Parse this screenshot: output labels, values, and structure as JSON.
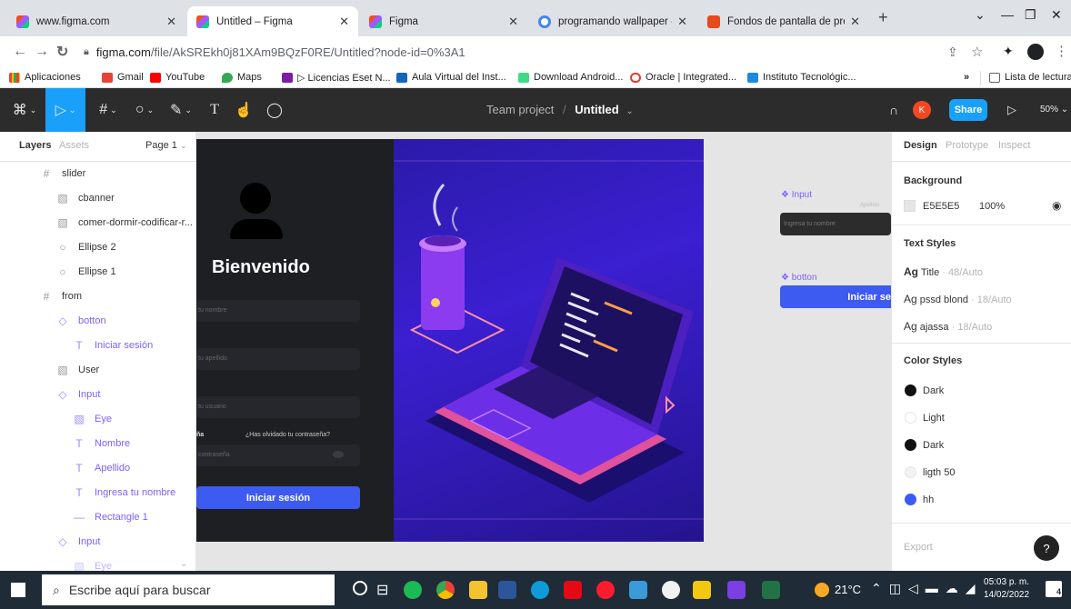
{
  "browser": {
    "tabs": [
      {
        "label": "www.figma.com"
      },
      {
        "label": "Untitled – Figma"
      },
      {
        "label": "Figma"
      },
      {
        "label": "programando wallpaper - Bú"
      },
      {
        "label": "Fondos de pantalla de progr"
      }
    ],
    "url_host": "figma.com",
    "url_path": "/file/AkSREkh0j81XAm9BQzF0RE/Untitled?node-id=0%3A1",
    "bookmarks": [
      "Aplicaciones",
      "Gmail",
      "YouTube",
      "Maps",
      "▷ Licencias Eset N...",
      "Aula Virtual del Inst...",
      "Download Android...",
      "Oracle | Integrated...",
      "Instituto Tecnológic..."
    ],
    "reading_list": "Lista de lectura"
  },
  "figma": {
    "project": "Team project",
    "file": "Untitled",
    "share": "Share",
    "zoom": "50%",
    "avatar": "K",
    "left_tabs": {
      "layers": "Layers",
      "assets": "Assets",
      "page": "Page 1"
    },
    "layers": [
      {
        "label": "slider"
      },
      {
        "label": "cbanner"
      },
      {
        "label": "comer-dormir-codificar-r..."
      },
      {
        "label": "Ellipse 2"
      },
      {
        "label": "Ellipse 1"
      },
      {
        "label": "from"
      },
      {
        "label": "botton"
      },
      {
        "label": "Iniciar sesión"
      },
      {
        "label": "User"
      },
      {
        "label": "Input"
      },
      {
        "label": "Eye"
      },
      {
        "label": "Nombre"
      },
      {
        "label": "Apellido"
      },
      {
        "label": "Ingresa tu nombre"
      },
      {
        "label": "Rectangle 1"
      },
      {
        "label": "Input"
      },
      {
        "label": "Eye"
      }
    ],
    "right_tabs": {
      "design": "Design",
      "prototype": "Prototype",
      "inspect": "Inspect"
    },
    "background": {
      "title": "Background",
      "hex": "E5E5E5",
      "opacity": "100%"
    },
    "text_styles": {
      "title": "Text Styles",
      "items": [
        {
          "name": "Title",
          "spec": "· 48/Auto"
        },
        {
          "name": "pssd blond",
          "spec": "· 18/Auto"
        },
        {
          "name": "ajassa",
          "spec": "· 18/Auto"
        }
      ]
    },
    "color_styles": {
      "title": "Color Styles",
      "items": [
        {
          "name": "Dark",
          "color": "#111111"
        },
        {
          "name": "Light",
          "color": "#ffffff"
        },
        {
          "name": "Dark",
          "color": "#111111"
        },
        {
          "name": "ligth 50",
          "color": "#f2f2f2"
        },
        {
          "name": "hh",
          "color": "#3b5bf5"
        }
      ]
    },
    "export": "Export",
    "help": "?",
    "canvas": {
      "welcome": "Bienvenido",
      "forgot": "¿Has olvidado tu contraseña?",
      "placeholders": [
        "tu nombre",
        "tu apellido",
        "tu usuario",
        "contraseña"
      ],
      "label_pw": "ña",
      "login_button": "Iniciar sesión",
      "input_comp_label": "Input",
      "input_comp_placeholder": "Ingresa tu nombre",
      "input_comp_nombre": "Nombre",
      "input_comp_apellido": "Apellido",
      "botton_comp_label": "botton",
      "botton_comp_text": "Iniciar se"
    }
  },
  "taskbar": {
    "search": "Escribe aquí para buscar",
    "temp": "21°C",
    "time": "05:03 p. m.",
    "date": "14/02/2022",
    "notif": "4"
  }
}
